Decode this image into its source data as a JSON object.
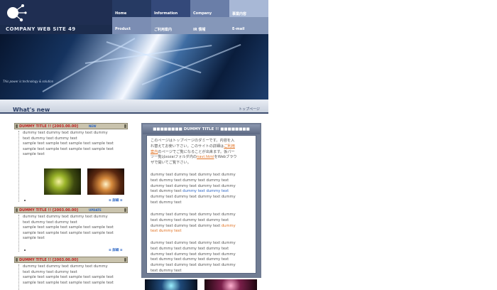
{
  "site": {
    "name": "COMPANY WEB SITE 49",
    "tagline": "This power is technology & solution"
  },
  "nav": {
    "top": [
      "Home",
      "Information",
      "Company",
      "事業内容"
    ],
    "bottom": [
      "Product",
      "ご利用案内",
      "IR 情報",
      "E-mail"
    ]
  },
  "section": {
    "title": "What's new",
    "breadcrumb": "トップページ"
  },
  "news": [
    {
      "title": "DUMMY TITLE !! [2003.00.00]",
      "badge": "NEW",
      "line1": "dummy text dummy text dummy text dummy",
      "line2": "text dummy text dummy text",
      "line3": "sample text sample text sample text sample text",
      "line4": "sample text sample text sample text sample text",
      "line5": "sample text",
      "more": "≡ 詳細 ≡"
    },
    {
      "title": "DUMMY TITLE !! [2003.00.00]",
      "badge": "UPDATE",
      "line1": "dummy text dummy text dummy text dummy",
      "line2": "text dummy text dummy text",
      "line3": "sample text sample text sample text sample text",
      "line4": "sample text sample text sample text sample text",
      "line5": "sample text",
      "more": "≡ 詳細 ≡"
    },
    {
      "title": "DUMMY TITLE !! [2003.00.00]",
      "line1": "dummy text dummy text dummy text dummy",
      "line2": "text dummy text dummy text",
      "line3": "sample text sample text sample text sample text",
      "line4": "sample text sample text sample text sample text"
    }
  ],
  "box": {
    "title": "■■■■■■■■ DUMMY TITLE !! ■■■■■■■■",
    "intro_a": "このページはトップページのダミーです。内容を入",
    "intro_b": "れ替えてお使い下さい。このサイトの詳細は",
    "intro_link": "ご利用",
    "intro_c": "案内",
    "intro_d": "のページでご覧になることが出来ます。仮パー",
    "intro_e": "ツ一覧はsozaiフォルダ内の",
    "intro_link2": "navi.html",
    "intro_f": "をWebブラウ",
    "intro_g": "ザで開いてご覧下さい。",
    "p1_1": "dummy text dummy text dummy text dummy",
    "p1_2": "text dummy text dummy text dummy text",
    "p1_3": "dummy text dummy text dummy text dummy",
    "p1_4a": "text dummy text ",
    "p1_4b": "dummy text dummy text",
    "p1_5": "dummy text dummy text dummy text dummy",
    "p1_6": "text dummy text",
    "p2_1": "dummy text dummy text dummy text dummy",
    "p2_2": "text dummy text dummy text dummy text",
    "p2_3a": "dummy text dummy text dummy text ",
    "p2_3b": "dummy",
    "p2_4": "text dummy text",
    "p3_1": "dummy text dummy text dummy text dummy",
    "p3_2": "text dummy text dummy text dummy text",
    "p3_3": "dummy text dummy text dummy text dummy",
    "p3_4": "text dummy text dummy text dummy text",
    "p3_5": "dummy text dummy text dummy text dummy",
    "p3_6": "text dummy text"
  }
}
